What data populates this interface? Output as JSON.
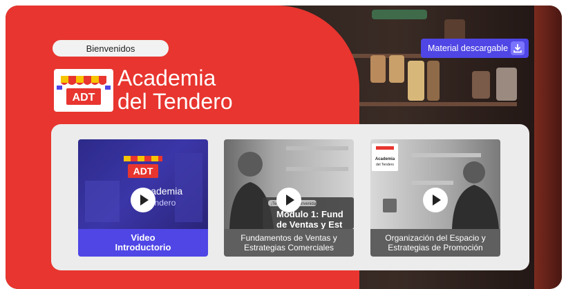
{
  "header": {
    "welcome": "Bienvenidos",
    "brand_line1": "Academia",
    "brand_line2": "del Tendero",
    "logo_text": "ADT"
  },
  "download": {
    "label": "Material descargable",
    "icon": "download-icon"
  },
  "videos": [
    {
      "caption_line1": "Video",
      "caption_line2": "Introductorio",
      "thumb_title_line1": "Academia",
      "thumb_title_line2": "del Tendero",
      "thumb_logo": "ADT"
    },
    {
      "caption_line1": "Fundamentos de Ventas y",
      "caption_line2": "Estrategias Comerciales",
      "thumb_overlay_small": "¡Te damos la bienvenida!",
      "thumb_overlay_line1": "Modulo 1: Fund",
      "thumb_overlay_line2": "de Ventas y Est"
    },
    {
      "caption_line1": "Organización del Espacio y",
      "caption_line2": "Estrategias de Promoción",
      "thumb_brand_line1": "Academia",
      "thumb_brand_line2": "del Tendero"
    }
  ],
  "colors": {
    "brand_red": "#e8352f",
    "accent_indigo": "#4f46e5",
    "card_caption_grey": "#5f5f5f"
  }
}
